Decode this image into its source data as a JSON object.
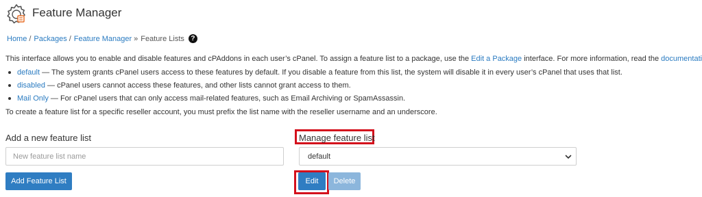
{
  "header": {
    "title": "Feature Manager",
    "icon": "feature-manager-icon"
  },
  "breadcrumb": {
    "items": [
      "Home",
      "Packages",
      "Feature Manager"
    ],
    "current": "Feature Lists",
    "separator": "/",
    "last_separator": "»"
  },
  "intro": {
    "text_before": "This interface allows you to enable and disable features and cPAddons in each user’s cPanel. To assign a feature list to a package, use the ",
    "link_package": "Edit a Package",
    "text_middle": " interface. For more information, read the ",
    "link_docs": "documentation",
    "text_after": "."
  },
  "bullets": [
    {
      "link": "default",
      "text": " — The system grants cPanel users access to these features by default. If you disable a feature from this list, the system will disable it in every user’s cPanel that uses that list."
    },
    {
      "link": "disabled",
      "text": " — cPanel users cannot access these features, and other lists cannot grant access to them."
    },
    {
      "link": "Mail Only",
      "text": " — For cPanel users that can only access mail-related features, such as Email Archiving or SpamAssassin."
    }
  ],
  "note": "To create a feature list for a specific reseller account, you must prefix the list name with the reseller username and an underscore.",
  "add_section": {
    "heading": "Add a new feature list",
    "input_placeholder": "New feature list name",
    "input_value": "",
    "button_label": "Add Feature List"
  },
  "manage_section": {
    "heading": "Manage feature list",
    "selected": "default",
    "edit_label": "Edit",
    "delete_label": "Delete"
  },
  "colors": {
    "link": "#2a7bc1",
    "primary_button": "#2f7dc2",
    "disabled_button": "#8cb6dc",
    "highlight": "#d4101c"
  }
}
